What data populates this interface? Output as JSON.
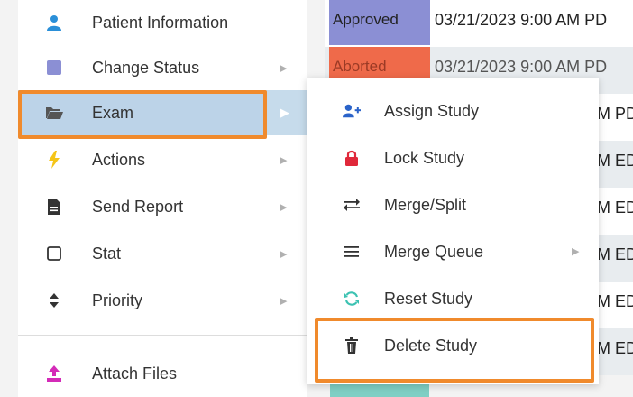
{
  "table_rows": [
    {
      "status": "Approved",
      "status_color": "#8b8fd4",
      "date": "03/21/2023 9:00 AM PD"
    },
    {
      "status": "Aborted",
      "status_color": "#ef6a4a",
      "date": "03/21/2023 9:00 AM PD"
    },
    {
      "status": "",
      "status_color": "",
      "date": "M PD"
    },
    {
      "status": "",
      "status_color": "",
      "date": "M ED"
    },
    {
      "status": "",
      "status_color": "",
      "date": "M ED"
    },
    {
      "status": "",
      "status_color": "",
      "date": "M ED"
    },
    {
      "status": "",
      "status_color": "",
      "date": "M ED"
    },
    {
      "status": "",
      "status_color": "",
      "date": "M ED"
    }
  ],
  "menu": {
    "items": [
      {
        "label": "Patient Information",
        "icon": "person-icon",
        "has_submenu": false
      },
      {
        "label": "Change Status",
        "icon": "square-icon",
        "has_submenu": true
      },
      {
        "label": "Exam",
        "icon": "folder-open-icon",
        "has_submenu": true,
        "active": true
      },
      {
        "label": "Actions",
        "icon": "lightning-icon",
        "has_submenu": true
      },
      {
        "label": "Send Report",
        "icon": "document-icon",
        "has_submenu": true
      },
      {
        "label": "Stat",
        "icon": "checkbox-icon",
        "has_submenu": true
      },
      {
        "label": "Priority",
        "icon": "sort-icon",
        "has_submenu": true
      },
      {
        "label": "Attach Files",
        "icon": "upload-icon",
        "has_submenu": false
      }
    ]
  },
  "submenu": {
    "items": [
      {
        "label": "Assign Study",
        "icon": "user-plus-icon",
        "has_submenu": false
      },
      {
        "label": "Lock Study",
        "icon": "lock-icon",
        "has_submenu": false
      },
      {
        "label": "Merge/Split",
        "icon": "arrows-exchange-icon",
        "has_submenu": false
      },
      {
        "label": "Merge Queue",
        "icon": "list-icon",
        "has_submenu": true
      },
      {
        "label": "Reset Study",
        "icon": "refresh-icon",
        "has_submenu": false
      },
      {
        "label": "Delete Study",
        "icon": "trash-icon",
        "has_submenu": false,
        "highlighted": true
      }
    ]
  },
  "colors": {
    "highlight": "#f08a2c",
    "active_row": "#bcd3e8"
  }
}
